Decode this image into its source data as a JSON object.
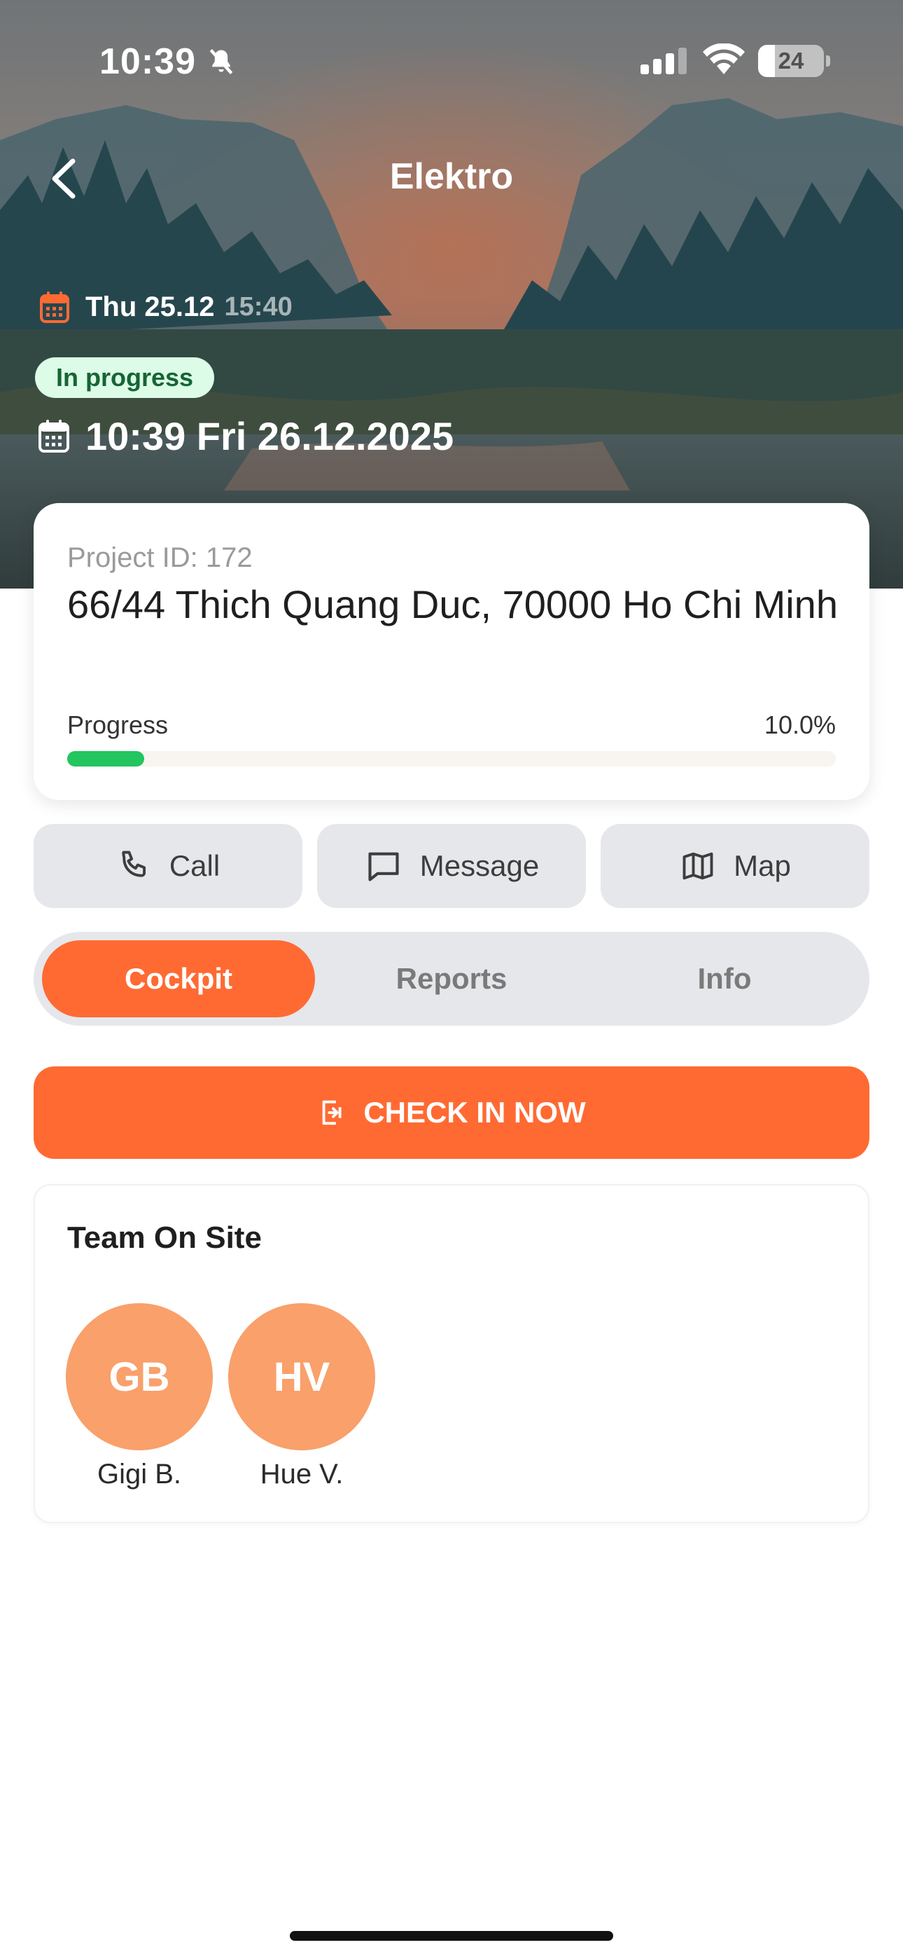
{
  "status_bar": {
    "time": "10:39",
    "battery": "24"
  },
  "header": {
    "title": "Elektro",
    "start_date": "Thu 25.12",
    "start_time": "15:40",
    "status_badge": "In progress",
    "due_datetime": "10:39 Fri 26.12.2025"
  },
  "project": {
    "id_label": "Project ID: 172",
    "address": "66/44 Thich Quang Duc, 70000 Ho Chi Minh",
    "progress_label": "Progress",
    "progress_value": "10.0%",
    "progress_fraction": 0.1
  },
  "actions": [
    {
      "label": "Call",
      "icon": "phone-icon"
    },
    {
      "label": "Message",
      "icon": "message-icon"
    },
    {
      "label": "Map",
      "icon": "map-icon"
    }
  ],
  "tabs": [
    {
      "label": "Cockpit",
      "active": true
    },
    {
      "label": "Reports",
      "active": false
    },
    {
      "label": "Info",
      "active": false
    }
  ],
  "check_in": {
    "label": "CHECK IN NOW",
    "icon": "check-in-icon"
  },
  "team": {
    "title": "Team On Site",
    "members": [
      {
        "initials": "GB",
        "name": "Gigi B."
      },
      {
        "initials": "HV",
        "name": "Hue V."
      }
    ]
  },
  "colors": {
    "accent": "#ff6a33",
    "progress": "#22c55e",
    "avatar": "#f9a06b",
    "badge_bg": "#dcfce7",
    "badge_text": "#166534"
  }
}
